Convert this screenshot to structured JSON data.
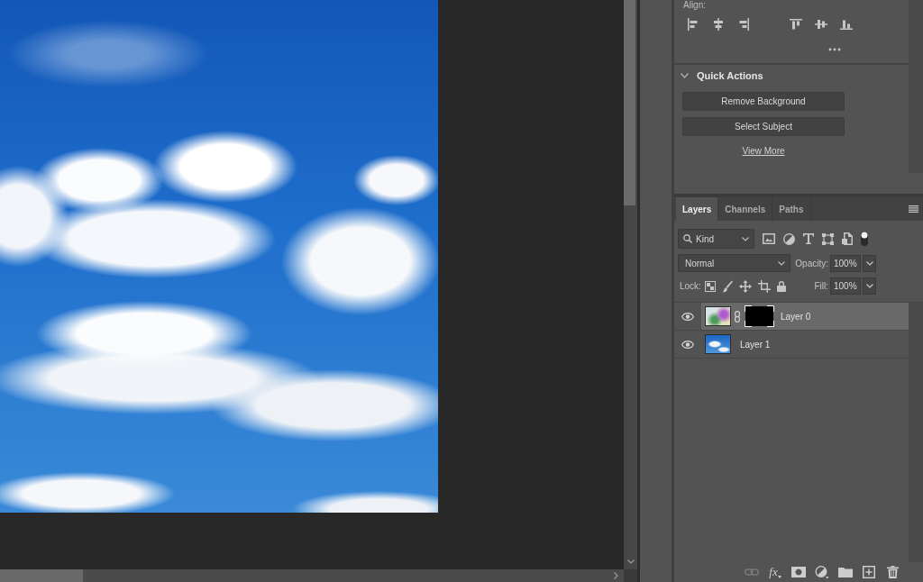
{
  "properties": {
    "align": {
      "label": "Align:"
    },
    "quick_actions": {
      "title": "Quick Actions",
      "expanded": true,
      "buttons": [
        "Remove Background",
        "Select Subject"
      ],
      "link": "View More"
    }
  },
  "layers_panel": {
    "tabs": [
      {
        "label": "Layers",
        "selected": true
      },
      {
        "label": "Channels",
        "selected": false
      },
      {
        "label": "Paths",
        "selected": false
      }
    ],
    "filter": {
      "value": "Kind",
      "on": true
    },
    "blend_mode": "Normal",
    "opacity": {
      "label": "Opacity:",
      "value": "100%"
    },
    "lock": {
      "label": "Lock:"
    },
    "fill": {
      "label": "Fill:",
      "value": "100%"
    },
    "layers": [
      {
        "name": "Layer 0",
        "selected": true,
        "visible": true,
        "mask": true
      },
      {
        "name": "Layer 1",
        "selected": false,
        "visible": true,
        "mask": false
      }
    ],
    "toolbar": [
      {
        "kind": "link",
        "disabled": true
      },
      {
        "kind": "fx",
        "label": "fx",
        "disabled": false
      },
      {
        "kind": "mask",
        "disabled": false
      },
      {
        "kind": "adjustment",
        "disabled": false
      },
      {
        "kind": "group",
        "disabled": false
      },
      {
        "kind": "new",
        "disabled": false
      },
      {
        "kind": "delete",
        "disabled": false
      }
    ]
  }
}
